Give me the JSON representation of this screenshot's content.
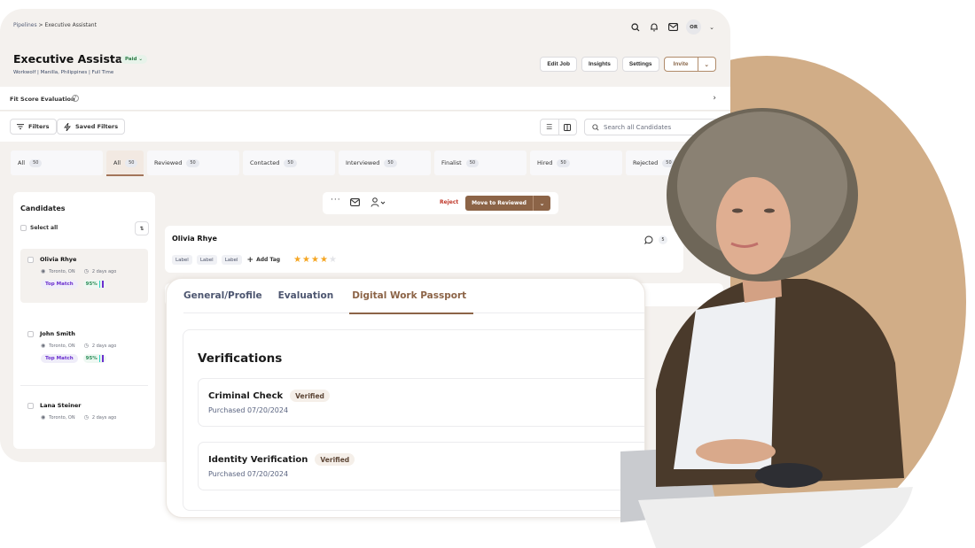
{
  "colors": {
    "accent": "#8c6447",
    "circle": "#d1ad87",
    "reject": "#c0392b",
    "top_match": "#6b2fcf",
    "match_pct": "#2d8f5a",
    "paid": "#2c7a45",
    "star": "#f5a623"
  },
  "breadcrumb": {
    "parent": "Pipelines",
    "separator": ">",
    "current": "Executive Assistant"
  },
  "header": {
    "avatar_initials": "OR",
    "icons": [
      "search-icon",
      "bell-icon",
      "mail-icon",
      "chevron-down-icon"
    ]
  },
  "job": {
    "title": "Executive Assistant",
    "status": "Paid",
    "subtitle": "Workwolf | Manilla, Philippines | Full Time"
  },
  "actions": {
    "edit_job": "Edit Job",
    "insights": "Insights",
    "settings": "Settings",
    "invite": "Invite"
  },
  "fit_score": {
    "label": "Fit Score Evaluation",
    "help": "?"
  },
  "filters": {
    "filters_label": "Filters",
    "saved_filters_label": "Saved Filters",
    "search_placeholder": "Search all Candidates"
  },
  "stages": [
    {
      "label": "All",
      "count": "50",
      "active": false
    },
    {
      "label": "All",
      "count": "50",
      "active": true
    },
    {
      "label": "Reviewed",
      "count": "50",
      "active": false
    },
    {
      "label": "Contacted",
      "count": "50",
      "active": false
    },
    {
      "label": "Interviewed",
      "count": "50",
      "active": false
    },
    {
      "label": "Finalist",
      "count": "50",
      "active": false
    },
    {
      "label": "Hired",
      "count": "50",
      "active": false
    },
    {
      "label": "Rejected",
      "count": "50",
      "active": false
    }
  ],
  "candidates_panel": {
    "title": "Candidates",
    "select_all": "Select all",
    "items": [
      {
        "name": "Olivia Rhye",
        "location": "Toronto, ON",
        "time": "2 days ago",
        "badge": "Top Match",
        "match": "95%",
        "selected": true
      },
      {
        "name": "John Smith",
        "location": "Toronto, ON",
        "time": "2 days ago",
        "badge": "Top Match",
        "match": "95%",
        "selected": false
      },
      {
        "name": "Lana Steiner",
        "location": "Toronto, ON",
        "time": "2 days ago",
        "selected": false
      }
    ]
  },
  "action_bar": {
    "reject": "Reject",
    "move": "Move to Reviewed"
  },
  "candidate": {
    "name": "Olivia Rhye",
    "labels": [
      "Label",
      "Label",
      "Label"
    ],
    "add_tag": "Add Tag",
    "rating": 4,
    "rating_max": 5,
    "comment_count": "5"
  },
  "detail": {
    "tabs": [
      {
        "label": "General/Profile",
        "active": false
      },
      {
        "label": "Evaluation",
        "active": false
      },
      {
        "label": "Digital Work Passport",
        "active": true
      }
    ],
    "section_title": "Verifications",
    "verifications": [
      {
        "title": "Criminal Check",
        "status": "Verified",
        "date": "Purchased 07/20/2024"
      },
      {
        "title": "Identity Verification",
        "status": "Verified",
        "date": "Purchased 07/20/2024"
      }
    ]
  }
}
